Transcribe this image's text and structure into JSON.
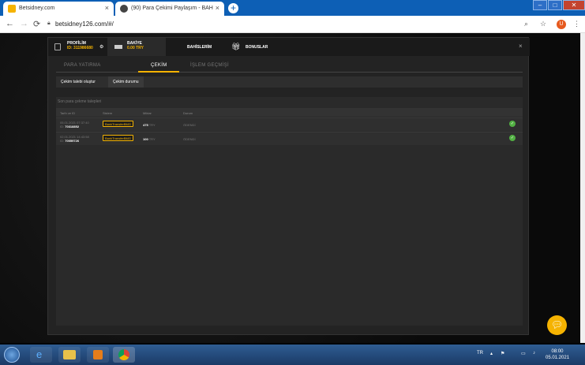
{
  "browser": {
    "tabs": [
      {
        "title": "Betsidney.com",
        "close": "×"
      },
      {
        "title": "(90) Para Çekimi Paylaşım - BAH",
        "close": "×"
      }
    ],
    "new_tab": "+",
    "window_buttons": [
      "–",
      "□",
      "✕"
    ],
    "nav": {
      "back": "←",
      "forward": "→",
      "reload": "C"
    },
    "url": "betsidney126.com/#/",
    "profile_initial": "U"
  },
  "modal": {
    "profile_label": "PROFİLİM",
    "profile_id": "ID: 311986680",
    "balance_label": "BAKİYE",
    "balance_value": "0.00 TRY",
    "bets_label": "BAHİSLERİM",
    "bonuses_label": "BONUSLAR",
    "close": "×",
    "tabs": [
      "PARA YATIRMA",
      "ÇEKİM",
      "İŞLEM GEÇMİŞİ"
    ],
    "active_tab": "ÇEKİM",
    "sub_buttons": [
      "Çekim talebi oluştur",
      "Çekim durumu"
    ],
    "panel_title": "Son para çekme talepleri",
    "columns": [
      "Tarih ve ID",
      "Sistem",
      "Miktar",
      "Durum"
    ],
    "rows": [
      {
        "date": "05.01.2021 07:37:40",
        "id_prefix": "ID:",
        "id": "70318852",
        "system": "BankTransferBMG",
        "amount": "475",
        "currency": "TRY",
        "status": "ÖDENDİ"
      },
      {
        "date": "02.01.2021 14:43:58",
        "id_prefix": "ID:",
        "id": "70059726",
        "system": "BankTransferBMG",
        "amount": "100",
        "currency": "TRY",
        "status": "ÖDENDİ"
      }
    ]
  },
  "taskbar": {
    "lang": "TR",
    "time": "08:00",
    "date": "05.01.2021"
  }
}
